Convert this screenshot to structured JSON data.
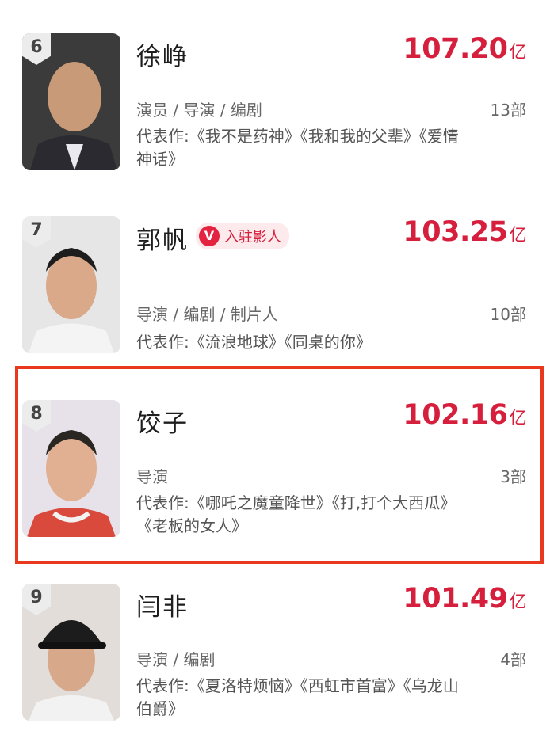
{
  "colors": {
    "box_office": "#d61f3c",
    "highlight_border": "#e8391f",
    "badge_bg": "#fdeaec"
  },
  "entries": [
    {
      "rank": "6",
      "name": "徐峥",
      "box_value": "107.20",
      "box_unit": "亿",
      "roles": "演员 / 导演 / 编剧",
      "count": "13部",
      "works": "代表作:《我不是药神》《我和我的父辈》《爱情神话》"
    },
    {
      "rank": "7",
      "name": "郭帆",
      "badge": {
        "icon": "V",
        "text": "入驻影人"
      },
      "box_value": "103.25",
      "box_unit": "亿",
      "roles": "导演 / 编剧 / 制片人",
      "count": "10部",
      "works": "代表作:《流浪地球》《同桌的你》"
    },
    {
      "rank": "8",
      "name": "饺子",
      "box_value": "102.16",
      "box_unit": "亿",
      "roles": "导演",
      "count": "3部",
      "works": "代表作:《哪吒之魔童降世》《打,打个大西瓜》《老板的女人》"
    },
    {
      "rank": "9",
      "name": "闫非",
      "box_value": "101.49",
      "box_unit": "亿",
      "roles": "导演 / 编剧",
      "count": "4部",
      "works": "代表作:《夏洛特烦恼》《西虹市首富》《乌龙山伯爵》"
    }
  ]
}
